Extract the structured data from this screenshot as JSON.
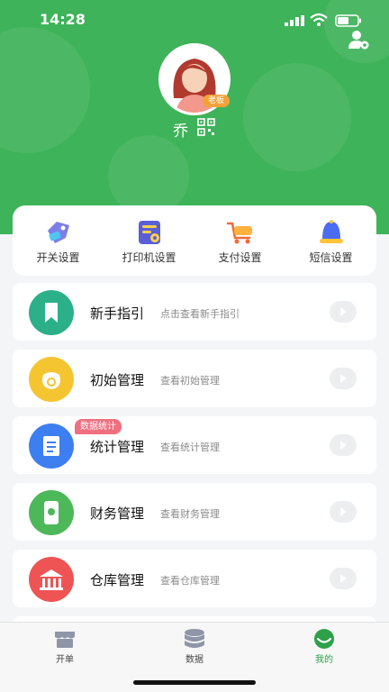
{
  "status_bar": {
    "time": "14:28"
  },
  "profile": {
    "name": "乔",
    "role_badge": "老板"
  },
  "quick_actions": [
    {
      "label": "开关设置",
      "icon": "switch-tag-icon"
    },
    {
      "label": "打印机设置",
      "icon": "printer-icon"
    },
    {
      "label": "支付设置",
      "icon": "cart-icon"
    },
    {
      "label": "短信设置",
      "icon": "bell-icon"
    }
  ],
  "menu": [
    {
      "title": "新手指引",
      "desc": "点击查看新手指引",
      "icon": "bookmark-icon",
      "color": "#2bb08a"
    },
    {
      "title": "初始管理",
      "desc": "查看初始管理",
      "icon": "money-bag-icon",
      "color": "#f5c531"
    },
    {
      "title": "统计管理",
      "desc": "查看统计管理",
      "icon": "clipboard-icon",
      "color": "#3d7ff0",
      "tag": "数据统计"
    },
    {
      "title": "财务管理",
      "desc": "查看财务管理",
      "icon": "phone-yuan-icon",
      "color": "#4cb85a"
    },
    {
      "title": "仓库管理",
      "desc": "查看仓库管理",
      "icon": "warehouse-icon",
      "color": "#ee5454"
    }
  ],
  "tabs": [
    {
      "label": "开单",
      "icon": "store-icon"
    },
    {
      "label": "数据",
      "icon": "database-icon"
    },
    {
      "label": "我的",
      "icon": "profile-face-icon"
    }
  ],
  "colors": {
    "brand": "#3fb35a",
    "active_tab": "#2ea04a",
    "tag": "#ef6f80"
  }
}
